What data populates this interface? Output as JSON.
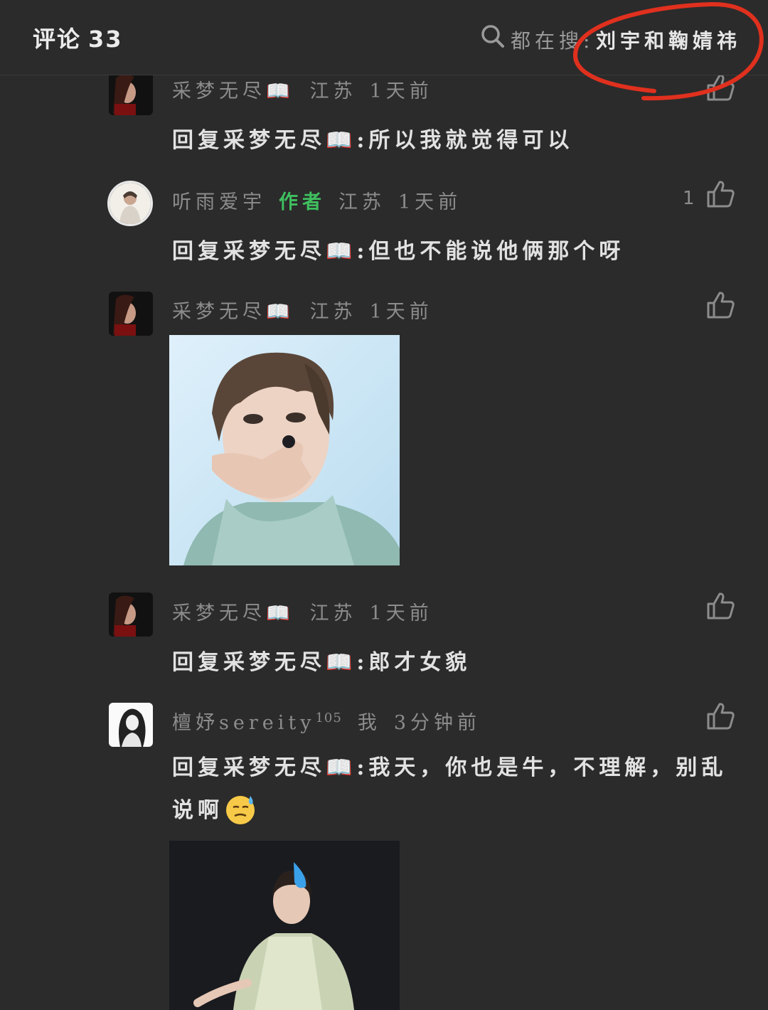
{
  "header": {
    "title": "评论",
    "count": "33",
    "search_prefix": "都在搜:",
    "search_query": "刘宇和鞠婧祎"
  },
  "comments": [
    {
      "user": "采梦无尽📖",
      "location": "江苏",
      "time": "1天前",
      "text": "回复采梦无尽📖:所以我就觉得可以"
    },
    {
      "user": "听雨爱宇",
      "author_tag": "作者",
      "location": "江苏",
      "time": "1天前",
      "likes": "1",
      "text": "回复采梦无尽📖:但也不能说他俩那个呀"
    },
    {
      "user": "采梦无尽📖",
      "location": "江苏",
      "time": "1天前",
      "text": ""
    },
    {
      "user": "采梦无尽📖",
      "location": "江苏",
      "time": "1天前",
      "text": "回复采梦无尽📖:郎才女貌"
    },
    {
      "user": "檀妤sereity",
      "user_sup": "105",
      "location": "我",
      "time": "3分钟前",
      "text": "回复采梦无尽📖:我天，你也是牛，不理解，别乱说啊"
    }
  ],
  "colors": {
    "background": "#2b2b2b",
    "author_tag": "#3fbf5f",
    "annotation_circle": "#e0301e"
  }
}
